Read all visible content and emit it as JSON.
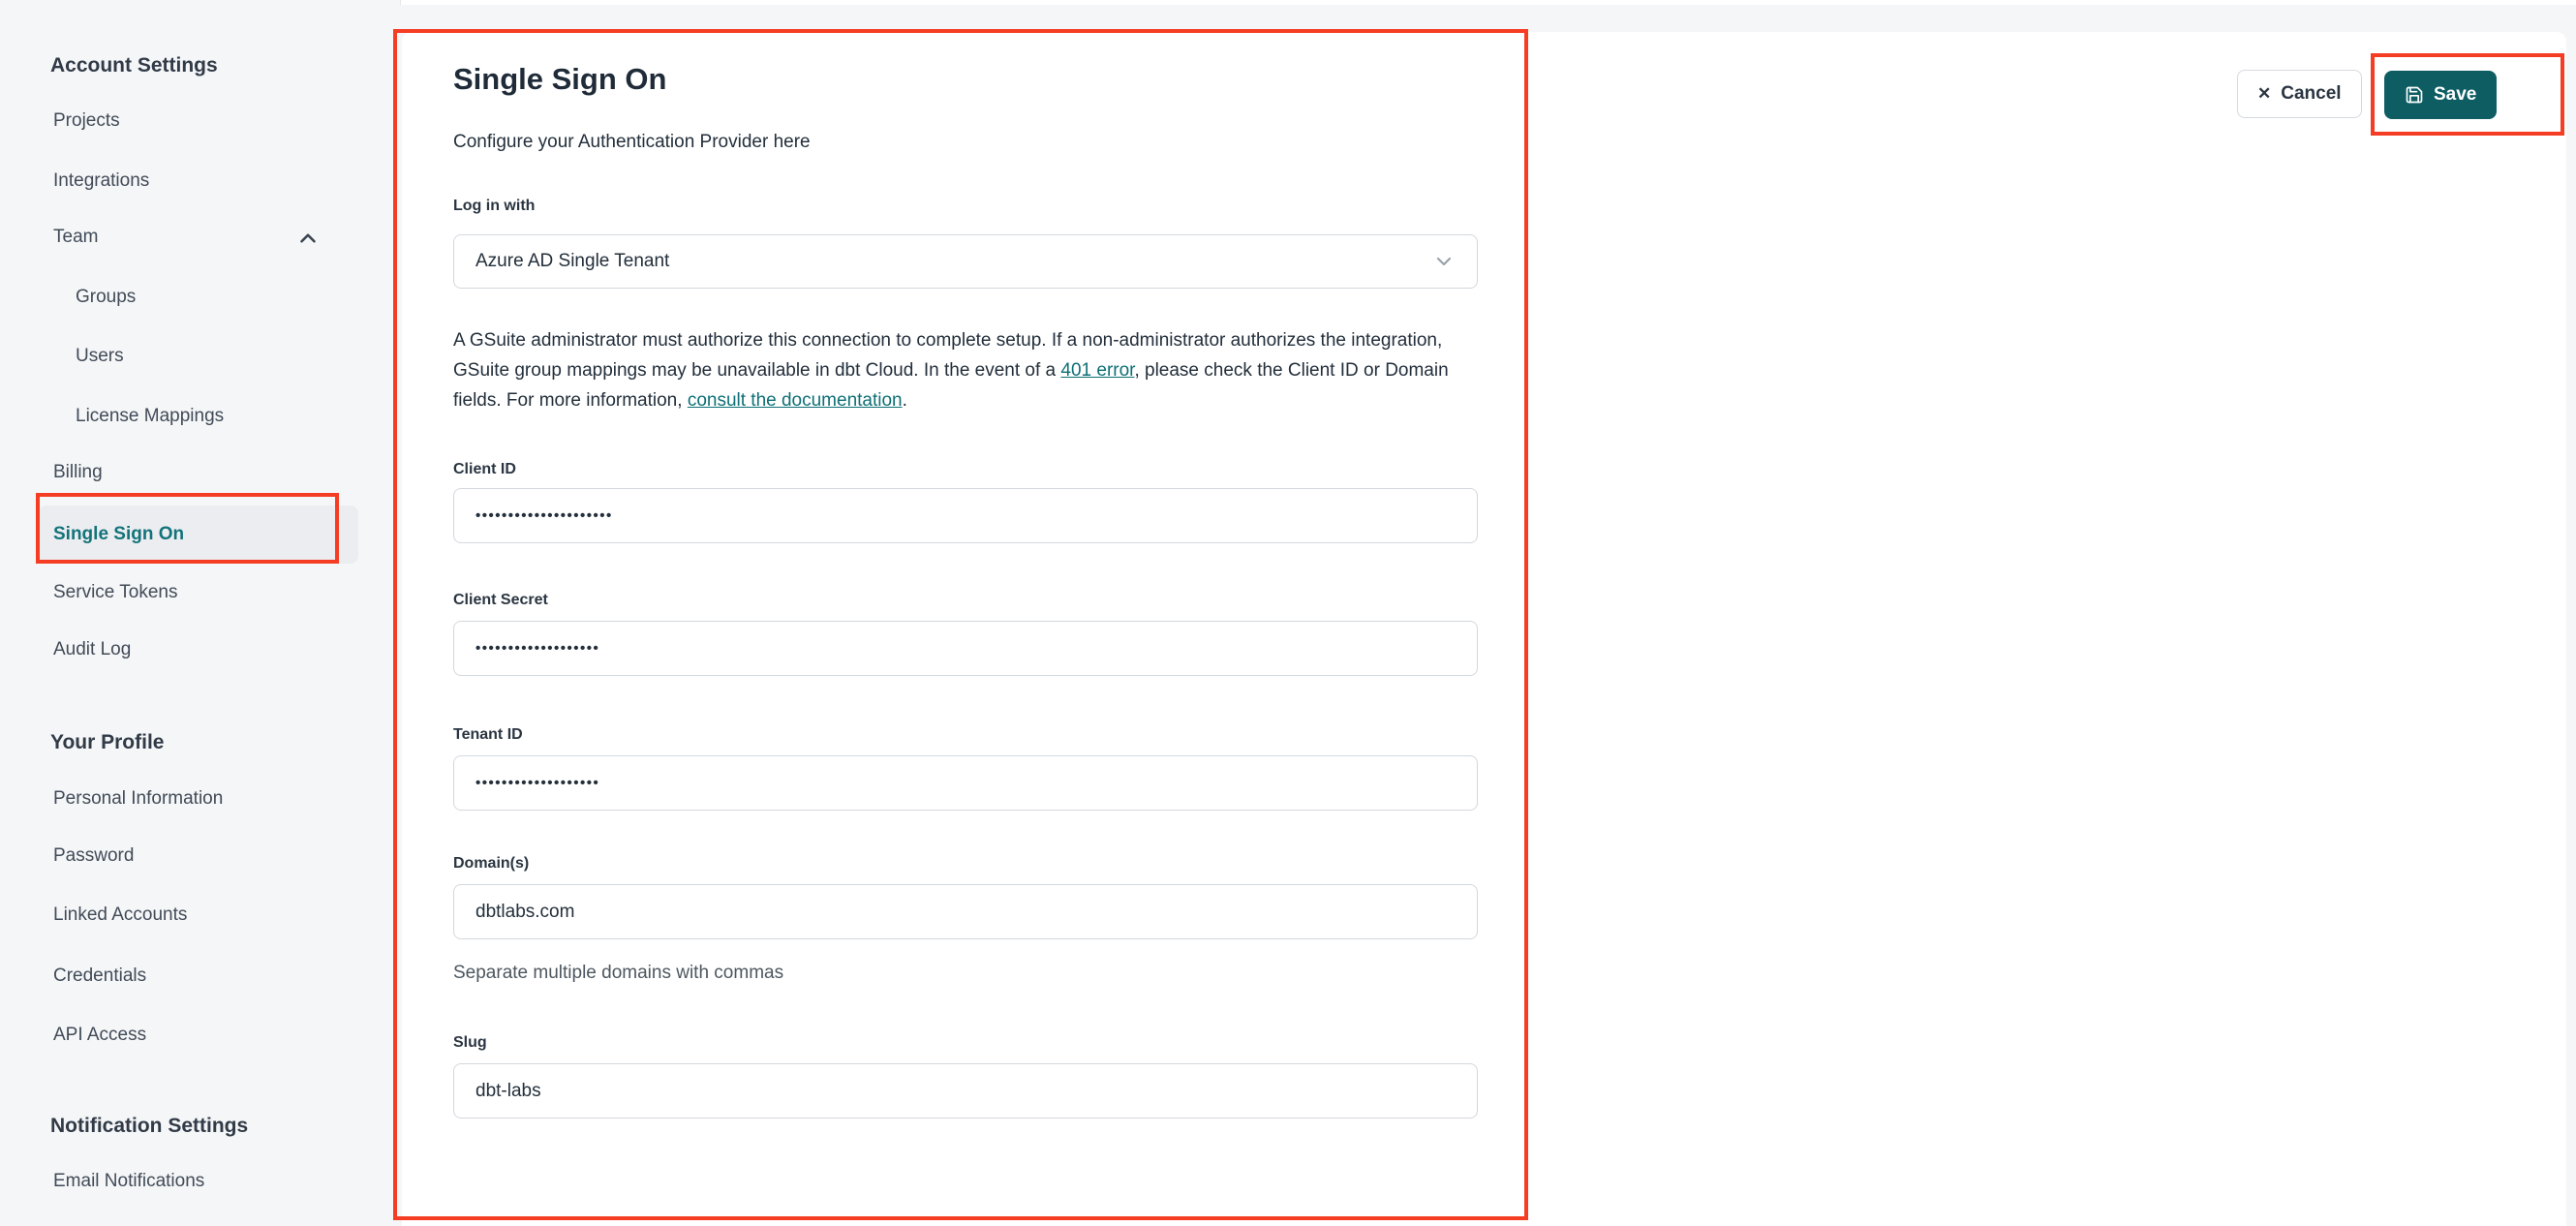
{
  "sidebar": {
    "sections": [
      {
        "header": "Account Settings",
        "items": [
          {
            "label": "Projects"
          },
          {
            "label": "Integrations"
          },
          {
            "label": "Team"
          },
          {
            "label": "Groups"
          },
          {
            "label": "Users"
          },
          {
            "label": "License Mappings"
          },
          {
            "label": "Billing"
          },
          {
            "label": "Single Sign On",
            "active": true
          },
          {
            "label": "Service Tokens"
          },
          {
            "label": "Audit Log"
          }
        ]
      },
      {
        "header": "Your Profile",
        "items": [
          {
            "label": "Personal Information"
          },
          {
            "label": "Password"
          },
          {
            "label": "Linked Accounts"
          },
          {
            "label": "Credentials"
          },
          {
            "label": "API Access"
          }
        ]
      },
      {
        "header": "Notification Settings",
        "items": [
          {
            "label": "Email Notifications"
          }
        ]
      }
    ]
  },
  "main": {
    "title": "Single Sign On",
    "subtitle": "Configure your Authentication Provider here",
    "login_with": {
      "label": "Log in with",
      "value": "Azure AD Single Tenant"
    },
    "notice": {
      "part1": "A GSuite administrator must authorize this connection to complete setup. If a non-administrator authorizes the integration, GSuite group mappings may be unavailable in dbt Cloud. In the event of a ",
      "link1": "401 error",
      "part2": ", please check the Client ID or Domain fields. For more information, ",
      "link2": "consult the documentation",
      "part3": "."
    },
    "fields": {
      "client_id": {
        "label": "Client ID",
        "value": "•••••••••••••••••••••"
      },
      "client_secret": {
        "label": "Client Secret",
        "value": "•••••••••••••••••••"
      },
      "tenant_id": {
        "label": "Tenant ID",
        "value": "•••••••••••••••••••"
      },
      "domains": {
        "label": "Domain(s)",
        "value": "dbtlabs.com",
        "helper": "Separate multiple domains with commas"
      },
      "slug": {
        "label": "Slug",
        "value": "dbt-labs"
      }
    }
  },
  "actions": {
    "cancel": "Cancel",
    "save": "Save"
  },
  "colors": {
    "save_button_teal": "#0d5d63",
    "link_teal": "#0e7076",
    "active_item_teal": "#13737a",
    "annotation_red": "#f53d23"
  }
}
